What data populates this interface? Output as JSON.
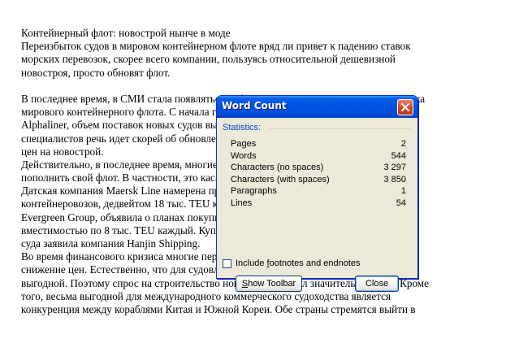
{
  "document": {
    "lines": [
      "Контейнерный флот: новострой нынче в моде",
      "Переизбыток судов в мировом контейнерном флоте вряд ли привет к падению ставок",
      "морских перевозок, скорее всего компании, пользуясь относительной дешевизной",
      "новостроя, просто обновят флот.",
      "",
      "В последнее время, в СМИ стала появляться информация о расширении судового ннажа",
      "мирового контейнерного флота. С начала года, по данным консалтингового агентства",
      "Alphaliner, объем поставок новых судов вырос на 11,4%. При этом, по мнению",
      "специалистов речь идет скорей об обновлении флота, связанном с доступностью",
      "цен на новострой.",
      "Действительно, в последнее время, многие компании заявили о намерениях",
      "пополнить свой флот. В частности, это касается контейнерных перевозок.",
      "Датская компания Maersk Line намерена приобрести до 20",
      "контейнеровозов, дедвейтом 18 тыс. TEU каждый. Компания",
      "Evergreen Group, объявила о планах покупки 20 судов,",
      "вместимостью по 8 тыс. TEU каждый. Купить новые",
      "суда заявила компания Hanjin Shipping.",
      "Во время финансового кризиса многие перевозчики отказались от этого шага как",
      "снижение цен. Естественно, что для судовладельцев такая ситуация оказалась весьма",
      "выгодной. Поэтому спрос на строительство новых судов начал значительно расти. Кроме",
      "того, весьма выгодной для международного коммерческого судоходства является",
      "конкуренция между кораблями Китая и Южной Кореи. Обе страны стремятся выйти в"
    ]
  },
  "dialog": {
    "title": "Word Count",
    "group_label": "Statistics:",
    "stats": [
      {
        "label": "Pages",
        "value": "2"
      },
      {
        "label": "Words",
        "value": "544"
      },
      {
        "label": "Characters (no spaces)",
        "value": "3 297"
      },
      {
        "label": "Characters (with spaces)",
        "value": "3 850"
      },
      {
        "label": "Paragraphs",
        "value": "1"
      },
      {
        "label": "Lines",
        "value": "54"
      }
    ],
    "checkbox_label_pre": "Include ",
    "checkbox_label_underline": "f",
    "checkbox_label_post": "ootnotes and endnotes",
    "checkbox_checked": false,
    "btn_toolbar_underline": "S",
    "btn_toolbar_rest": "how Toolbar",
    "btn_close": "Close"
  }
}
